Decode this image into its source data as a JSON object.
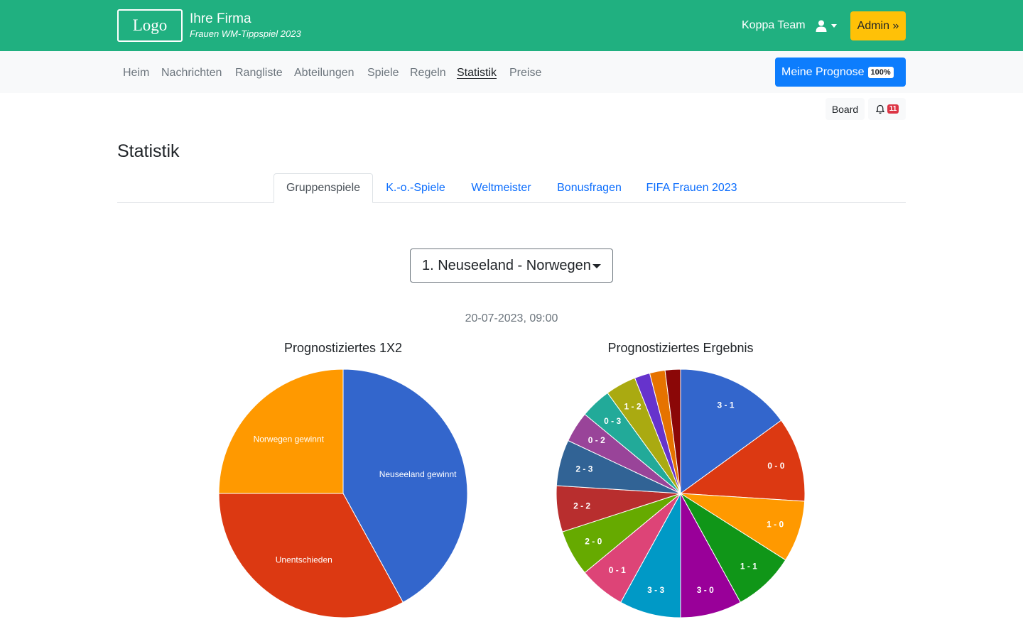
{
  "header": {
    "logo_text": "Logo",
    "brand_name": "Ihre Firma",
    "brand_subtitle": "Frauen WM-Tippspiel 2023",
    "team_name": "Koppa Team",
    "admin_label": "Admin »"
  },
  "nav": {
    "items": [
      {
        "label": "Heim"
      },
      {
        "label": "Nachrichten"
      },
      {
        "label": "Rangliste"
      },
      {
        "label": "Abteilungen"
      },
      {
        "label": "Spiele"
      },
      {
        "label": "Regeln"
      },
      {
        "label": "Statistik"
      },
      {
        "label": "Preise"
      }
    ],
    "prognose_label": "Meine Prognose",
    "prognose_badge": "100%"
  },
  "toolbar": {
    "board_label": "Board",
    "notification_count": "11"
  },
  "page": {
    "title": "Statistik",
    "tabs": [
      {
        "label": "Gruppenspiele"
      },
      {
        "label": "K.-o.-Spiele"
      },
      {
        "label": "Weltmeister"
      },
      {
        "label": "Bonusfragen"
      },
      {
        "label": "FIFA Frauen 2023"
      }
    ],
    "match_select_value": "1. Neuseeland - Norwegen",
    "match_date": "20-07-2023, 09:00"
  },
  "chart_data": [
    {
      "type": "pie",
      "title": "Prognostiziertes 1X2",
      "slices": [
        {
          "label": "Neuseeland gewinnt",
          "value": 42,
          "color": "#3366cc"
        },
        {
          "label": "Unentschieden",
          "value": 33,
          "color": "#dc3912"
        },
        {
          "label": "Norwegen gewinnt",
          "value": 25,
          "color": "#ff9900"
        }
      ]
    },
    {
      "type": "pie",
      "title": "Prognostiziertes Ergebnis",
      "slices": [
        {
          "label": "3 - 1",
          "value": 15,
          "color": "#3366cc"
        },
        {
          "label": "0 - 0",
          "value": 11,
          "color": "#dc3912"
        },
        {
          "label": "1 - 0",
          "value": 8,
          "color": "#ff9900"
        },
        {
          "label": "1 - 1",
          "value": 8,
          "color": "#109618"
        },
        {
          "label": "3 - 0",
          "value": 8,
          "color": "#990099"
        },
        {
          "label": "3 - 3",
          "value": 8,
          "color": "#0099c6"
        },
        {
          "label": "0 - 1",
          "value": 6,
          "color": "#dd4477"
        },
        {
          "label": "2 - 0",
          "value": 6,
          "color": "#66aa00"
        },
        {
          "label": "2 - 2",
          "value": 6,
          "color": "#b82e2e"
        },
        {
          "label": "2 - 3",
          "value": 6,
          "color": "#316395"
        },
        {
          "label": "0 - 2",
          "value": 4,
          "color": "#994499"
        },
        {
          "label": "0 - 3",
          "value": 4,
          "color": "#22aa99"
        },
        {
          "label": "1 - 2",
          "value": 4,
          "color": "#aaaa11"
        },
        {
          "label": "",
          "value": 2,
          "color": "#6633cc"
        },
        {
          "label": "",
          "value": 2,
          "color": "#e67300"
        },
        {
          "label": "",
          "value": 2,
          "color": "#8b0707"
        }
      ]
    }
  ]
}
